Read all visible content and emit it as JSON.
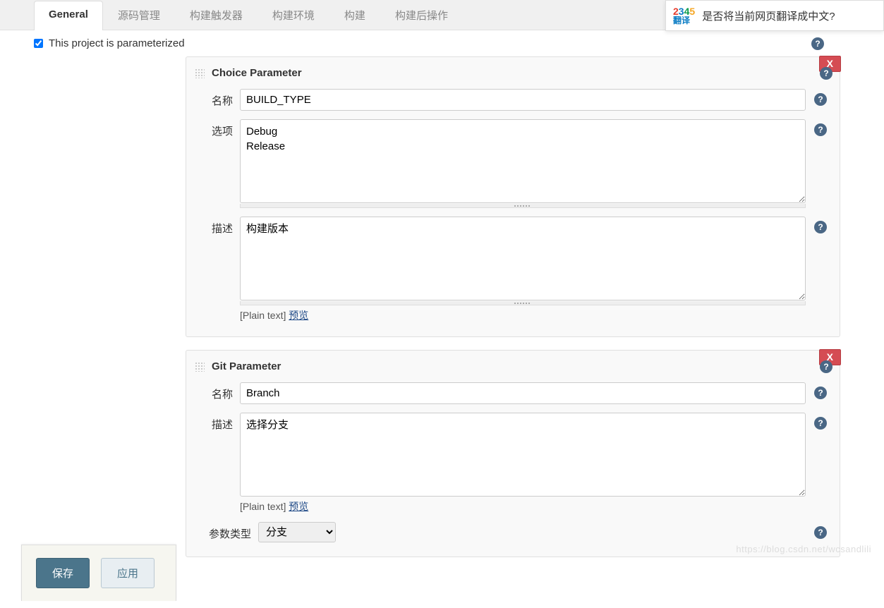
{
  "tabs": {
    "general": "General",
    "scm": "源码管理",
    "triggers": "构建触发器",
    "env": "构建环境",
    "build": "构建",
    "post": "构建后操作"
  },
  "parameterized_label": "This project is parameterized",
  "parameterized_checked": true,
  "choice_param": {
    "title": "Choice Parameter",
    "name_label": "名称",
    "name_value": "BUILD_TYPE",
    "options_label": "选项",
    "options_value": "Debug\nRelease",
    "desc_label": "描述",
    "desc_value": "构建版本",
    "plaintext_label": "[Plain text]",
    "preview_link": "预览",
    "delete_label": "X"
  },
  "git_param": {
    "title": "Git Parameter",
    "name_label": "名称",
    "name_value": "Branch",
    "desc_label": "描述",
    "desc_value": "选择分支",
    "plaintext_label": "[Plain text]",
    "preview_link": "预览",
    "paramtype_label": "参数类型",
    "paramtype_value": "分支",
    "delete_label": "X"
  },
  "buttons": {
    "save": "保存",
    "apply": "应用"
  },
  "translate_popup": {
    "logo_digits": [
      "2",
      "3",
      "4",
      "5"
    ],
    "logo_sub": "翻译",
    "text": "是否将当前网页翻译成中文?"
  },
  "watermark": "https://blog.csdn.net/wcsandlili"
}
